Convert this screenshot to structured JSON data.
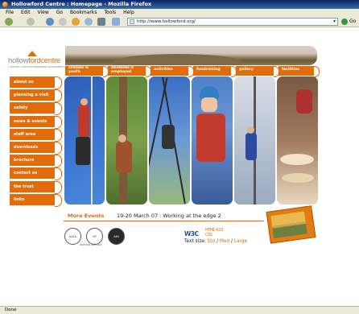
{
  "browser": {
    "title": "Hollowford Centre : Homepage - Mozilla Firefox",
    "menu": [
      "File",
      "Edit",
      "View",
      "Go",
      "Bookmarks",
      "Tools",
      "Help"
    ],
    "url": "http://www.hollowford.org/",
    "go_label": "Go",
    "status": "Done"
  },
  "site": {
    "logo_hollow": "hollow",
    "logo_ford": "fordcentre",
    "logo_tagline": "A HISTORIC CASTLETON RESIDENTIAL ENVIRONMENT",
    "accent_color": "#e36c0a"
  },
  "tabs": [
    {
      "line1": "schools &",
      "line2": "youth"
    },
    {
      "line1": "students &",
      "line2": "employed"
    },
    {
      "line1": "activities",
      "line2": ""
    },
    {
      "line1": "fundraising",
      "line2": ""
    },
    {
      "line1": "gallery",
      "line2": ""
    },
    {
      "line1": "facilities",
      "line2": ""
    }
  ],
  "nav": [
    "about us",
    "planning a visit",
    "safety",
    "news & events",
    "staff area",
    "downloads",
    "brochure",
    "contact us",
    "the trust",
    "links"
  ],
  "events": {
    "label": "More Events",
    "text": "19-20 March 07 : Working at the edge 2"
  },
  "affiliations": {
    "badges": [
      "AALA",
      "IIP",
      "AMI"
    ],
    "caption": "INVESTOR IN PEOPLE"
  },
  "validation": {
    "w3c": "W3C",
    "html": "HTML 4.01",
    "css": "CSS",
    "text_size_label": "Text size:",
    "sizes": [
      "Std",
      "Med",
      "Large"
    ],
    "sep": " / "
  }
}
